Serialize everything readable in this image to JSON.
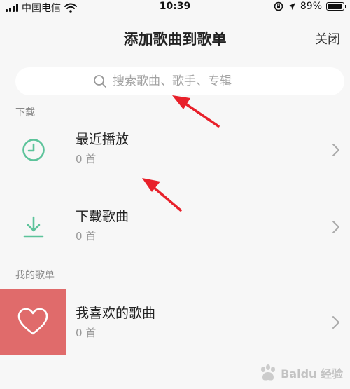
{
  "status_bar": {
    "carrier": "中国电信",
    "time": "10:39",
    "battery": "89%",
    "battery_level": 0.89
  },
  "header": {
    "title": "添加歌曲到歌单",
    "close_label": "关闭"
  },
  "search": {
    "placeholder": "搜索歌曲、歌手、专辑"
  },
  "sections": {
    "download_label": "下载",
    "my_playlists_label": "我的歌单"
  },
  "rows": [
    {
      "title": "最近播放",
      "count": "0 首",
      "icon": "clock-icon"
    },
    {
      "title": "下载歌曲",
      "count": "0 首",
      "icon": "download-icon"
    },
    {
      "title": "我喜欢的歌曲",
      "count": "0 首",
      "icon": "heart-icon"
    }
  ],
  "colors": {
    "accent_green": "#5cc39a",
    "cover_red": "#e06b6b",
    "annotation_red": "#e8202a"
  },
  "watermark": "Baidu 经验"
}
